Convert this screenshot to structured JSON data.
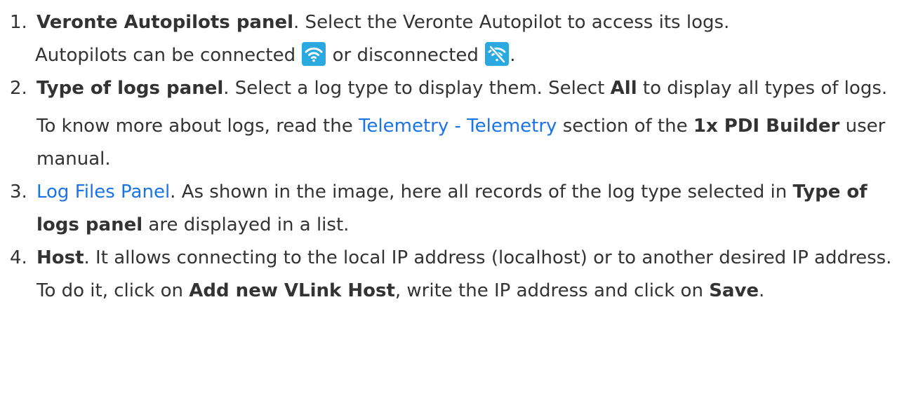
{
  "list": [
    {
      "number": "1.",
      "title": "Veronte Autopilots panel",
      "text1": ". Select the Veronte Autopilot to access its logs.",
      "line2_pre": "Autopilots can be connected",
      "line2_mid": " or disconnected",
      "line2_end": ".",
      "icon_connected": "wifi-connected-icon",
      "icon_disconnected": "wifi-disconnected-icon"
    },
    {
      "number": "2.",
      "title": "Type of logs panel",
      "text1": ". Select a log type to display them. Select ",
      "bold_all": "All",
      "text2": " to display all types of logs.",
      "note_pre": "To know more about logs, read the ",
      "note_link": "Telemetry - Telemetry",
      "note_mid": " section of the ",
      "note_bold": "1x PDI Builder",
      "note_end": " user manual."
    },
    {
      "number": "3.",
      "link": "Log Files Panel",
      "text1": ". As shown in the image, here all records of the log type selected in ",
      "bold": "Type of logs panel",
      "text2": " are displayed in a list."
    },
    {
      "number": "4.",
      "title": "Host",
      "text1": ". It allows connecting to the local IP address (localhost) or to another desired IP address. To do it, click on ",
      "bold1": "Add new VLink Host",
      "text2": ", write the IP address and click on ",
      "bold2": "Save",
      "text3": "."
    }
  ],
  "colors": {
    "text": "#333333",
    "link": "#1a73e8",
    "icon_bg": "#2aa8e0"
  }
}
